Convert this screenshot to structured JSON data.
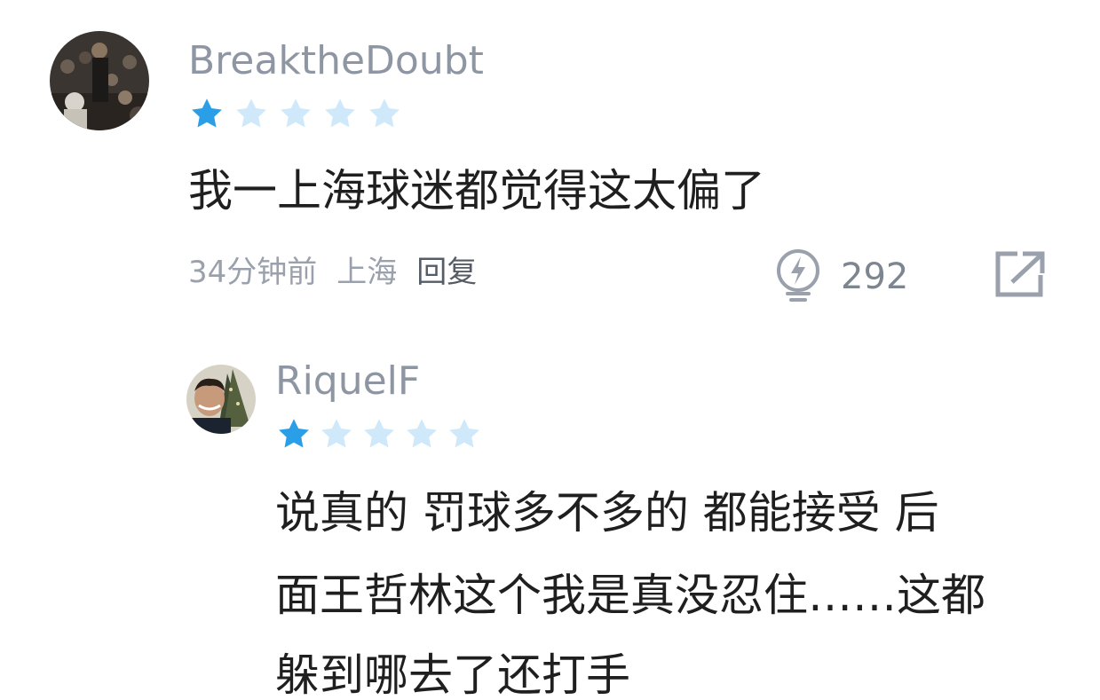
{
  "comments": [
    {
      "username": "BreaktheDoubt",
      "rating": 1,
      "max_rating": 5,
      "text_lines": [
        "我一上海球迷都觉得这太偏了"
      ],
      "time": "34分钟前",
      "location": "上海",
      "reply_label": "回复",
      "like_count": "292"
    },
    {
      "username": "RiquelF",
      "rating": 1,
      "max_rating": 5,
      "text_lines": [
        "说真的 罚球多不多的 都能接受 后",
        "面王哲林这个我是真没忍住……这都",
        "躲到哪去了还打手"
      ]
    }
  ],
  "icons": {
    "like": "lightbulb-bolt-icon",
    "share": "share-arrow-icon",
    "star": "star-icon"
  },
  "colors": {
    "star_filled": "#2a9fe8",
    "star_empty": "#cfe9fa",
    "username": "#8e96a3",
    "meta": "#9aa1ac",
    "text": "#1f1f1f"
  }
}
